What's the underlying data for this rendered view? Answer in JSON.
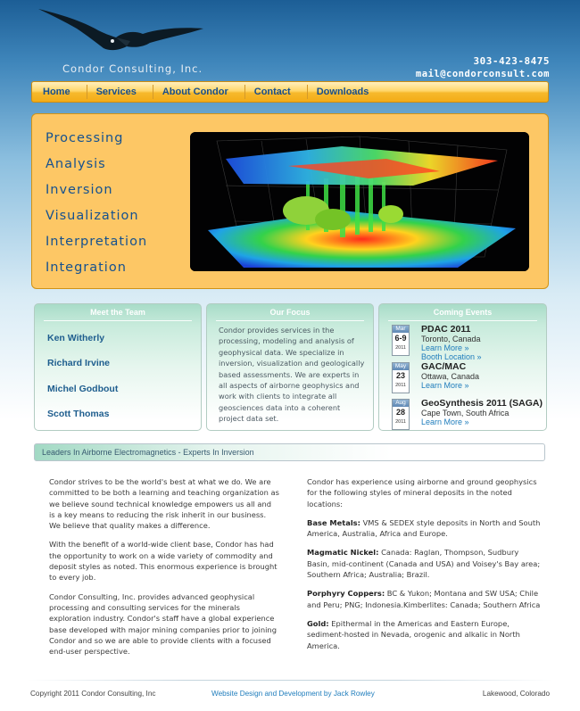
{
  "brand": {
    "name": "Condor Consulting, Inc.",
    "phone": "303-423-8475",
    "email": "mail@condorconsult.com"
  },
  "nav": {
    "items": [
      {
        "label": "Home"
      },
      {
        "label": "Services"
      },
      {
        "label": "About Condor"
      },
      {
        "label": "Contact"
      },
      {
        "label": "Downloads"
      }
    ]
  },
  "hero": {
    "words": [
      "Processing",
      "Analysis",
      "Inversion",
      "Visualization",
      "Interpretation",
      "Integration"
    ]
  },
  "team": {
    "title": "Meet the Team",
    "members": [
      "Ken Witherly",
      "Richard Irvine",
      "Michel Godbout",
      "Scott Thomas"
    ]
  },
  "focus": {
    "title": "Our Focus",
    "text": "Condor provides services in the processing, modeling and analysis of geophysical data. We specialize in inversion, visualization and geologically based assessments. We are experts in all aspects of airborne geophysics and work with clients to integrate all geosciences data into a coherent project data set."
  },
  "events": {
    "title": "Coming Events",
    "items": [
      {
        "month": "Mar",
        "day": "6-9",
        "year": "2011",
        "name": "PDAC 2011",
        "location": "Toronto, Canada",
        "links": [
          "Learn More »",
          "Booth Location »"
        ]
      },
      {
        "month": "May",
        "day": "23",
        "year": "2011",
        "name": "GAC/MAC",
        "location": "Ottawa, Canada",
        "links": [
          "Learn More »"
        ]
      },
      {
        "month": "Aug",
        "day": "28",
        "year": "2011",
        "name": "GeoSynthesis 2011 (SAGA)",
        "location": "Cape Town, South Africa",
        "links": [
          "Learn More »"
        ]
      }
    ]
  },
  "tagline": "Leaders In Airborne Electromagnetics - Experts In Inversion",
  "content": {
    "left": [
      "Condor strives to be the world's best at what we do. We are committed to be both a learning and teaching organization as we believe sound technical knowledge empowers us all and is a key means to reducing the risk inherit in our business. We believe that quality makes a difference.",
      "With the benefit of a world-wide client base, Condor has had the opportunity to work on a wide variety of commodity and deposit styles as noted. This enormous experience is brought to every job.",
      "Condor Consulting, Inc. provides advanced geophysical processing and consulting services for the minerals exploration industry. Condor's staff have a global experience base developed with major mining companies prior to joining Condor and so we are able to provide clients with a focused end-user perspective."
    ],
    "right_intro": "Condor has experience using airborne and ground geophysics for the following styles of mineral deposits in the noted locations:",
    "deposits": [
      {
        "label": "Base Metals:",
        "text": " VMS & SEDEX style deposits in North and South America, Australia, Africa and Europe."
      },
      {
        "label": "Magmatic Nickel:",
        "text": " Canada: Raglan, Thompson, Sudbury Basin, mid-continent (Canada and USA) and Voisey's Bay area; Southern Africa; Australia; Brazil."
      },
      {
        "label": "Porphyry Coppers:",
        "text": " BC & Yukon; Montana and SW USA; Chile and Peru; PNG; Indonesia.Kimberlites: Canada; Southern Africa"
      },
      {
        "label": "Gold:",
        "text": " Epithermal in the Americas and Eastern Europe, sediment-hosted in Nevada, orogenic and alkalic in North America."
      }
    ]
  },
  "footer": {
    "copyright": "Copyright 2011 Condor Consulting, Inc",
    "design": "Website Design and Development by Jack Rowley",
    "location": "Lakewood, Colorado"
  },
  "colors": {
    "header_blue": "#1c5e96",
    "nav_gold": "#f6b92c",
    "hero_gold": "#fdc765",
    "link_blue": "#1f7dbc",
    "panel_green": "#a8dcc8"
  }
}
